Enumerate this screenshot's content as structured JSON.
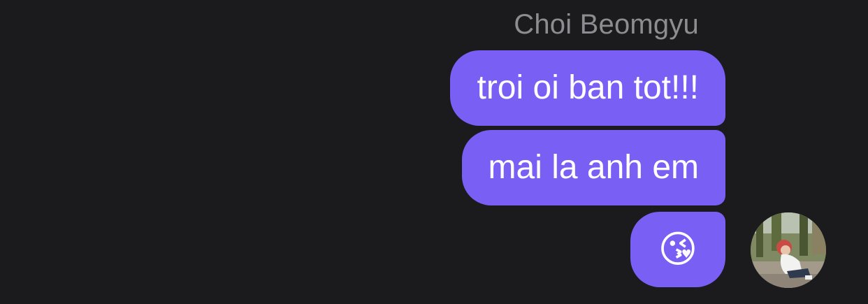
{
  "conversation": {
    "sender_name": "Choi Beomgyu",
    "messages": [
      {
        "text": "troi oi ban tot!!!"
      },
      {
        "text": "mai la anh em"
      },
      {
        "text": "😘"
      }
    ],
    "avatar": {
      "icon": "profile-photo"
    },
    "colors": {
      "background": "#1b1a1d",
      "bubble": "#7a5ff5",
      "sender_name": "#8d8c91",
      "message_text": "#ffffff"
    }
  }
}
